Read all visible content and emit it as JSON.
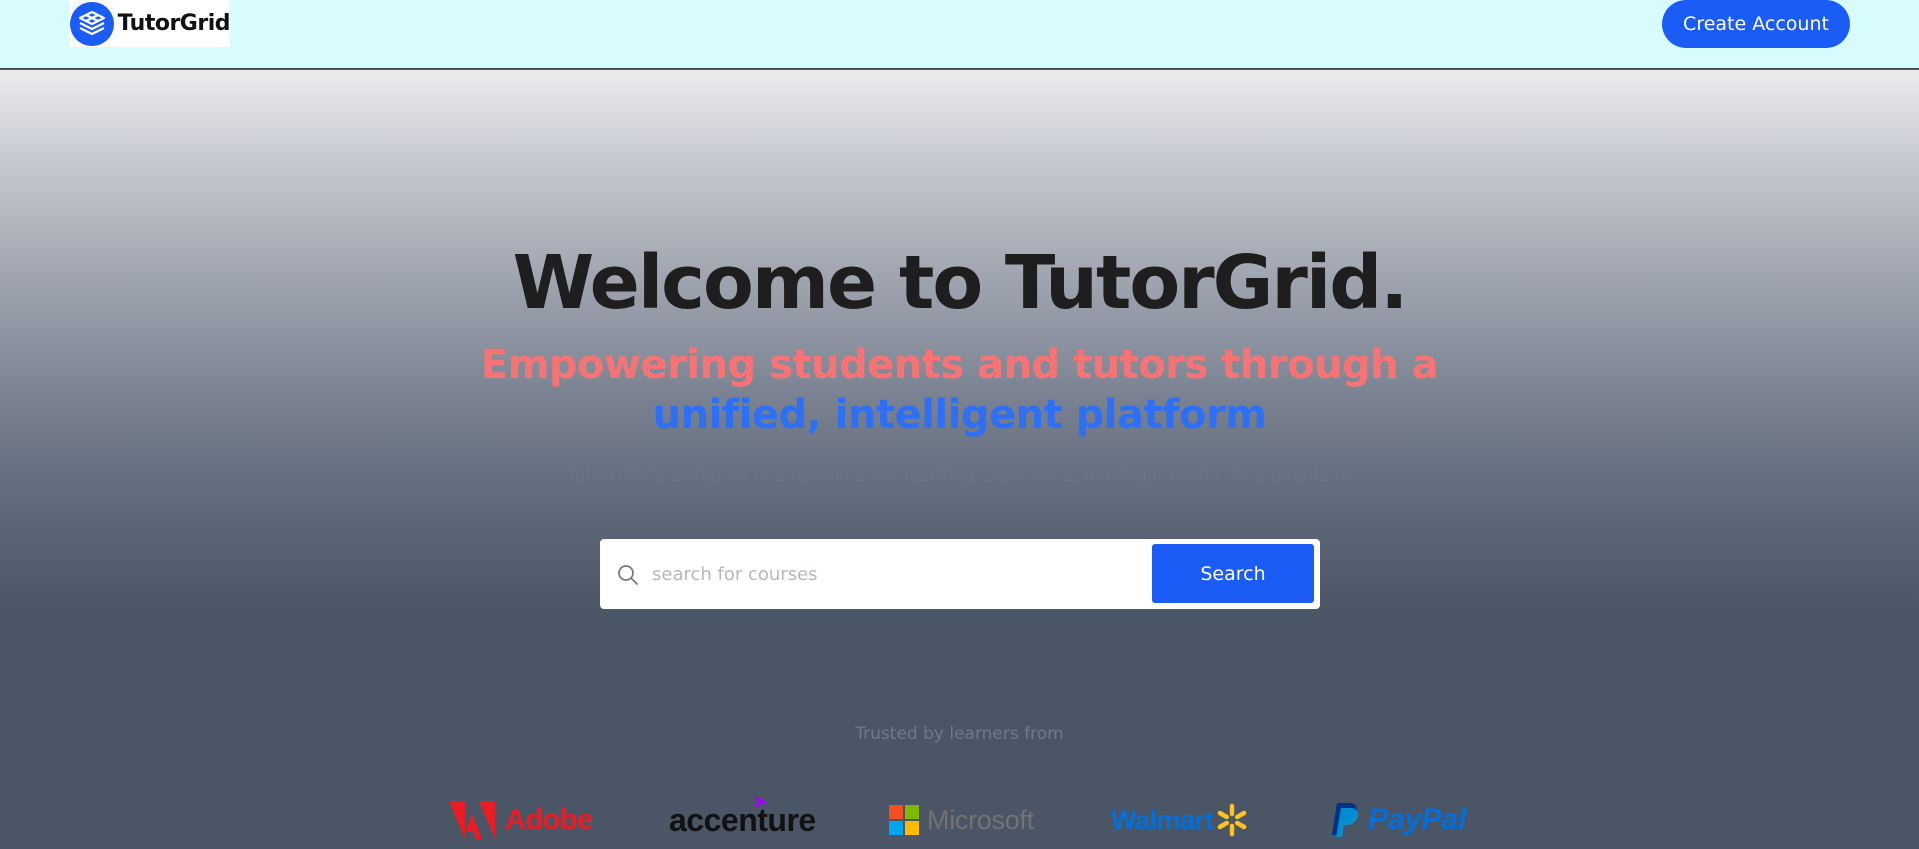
{
  "header": {
    "brand_name": "TutorGrid",
    "create_account_label": "Create Account"
  },
  "hero": {
    "headline": "Welcome to TutorGrid.",
    "subhead_red": "Empowering students and tutors through a",
    "subhead_blue": "unified, intelligent platform",
    "description": "TutorGrid is designed to streamline the learning experience, making it easier for students to"
  },
  "search": {
    "placeholder": "search for courses",
    "value": "",
    "button_label": "Search",
    "icon": "search-icon"
  },
  "trusted": {
    "label": "Trusted by learners from",
    "brands": [
      {
        "name": "Adobe",
        "icon": "adobe-logo-icon"
      },
      {
        "name": "accenture",
        "icon": "accenture-logo-icon"
      },
      {
        "name": "Microsoft",
        "icon": "microsoft-logo-icon"
      },
      {
        "name": "Walmart",
        "icon": "walmart-spark-icon"
      },
      {
        "name": "PayPal",
        "icon": "paypal-logo-icon"
      }
    ]
  },
  "colors": {
    "accent": "#1a5cf5",
    "header_bg": "#d8fbfe",
    "subhead_red": "#f97374",
    "subhead_blue": "#2d6ff7"
  }
}
